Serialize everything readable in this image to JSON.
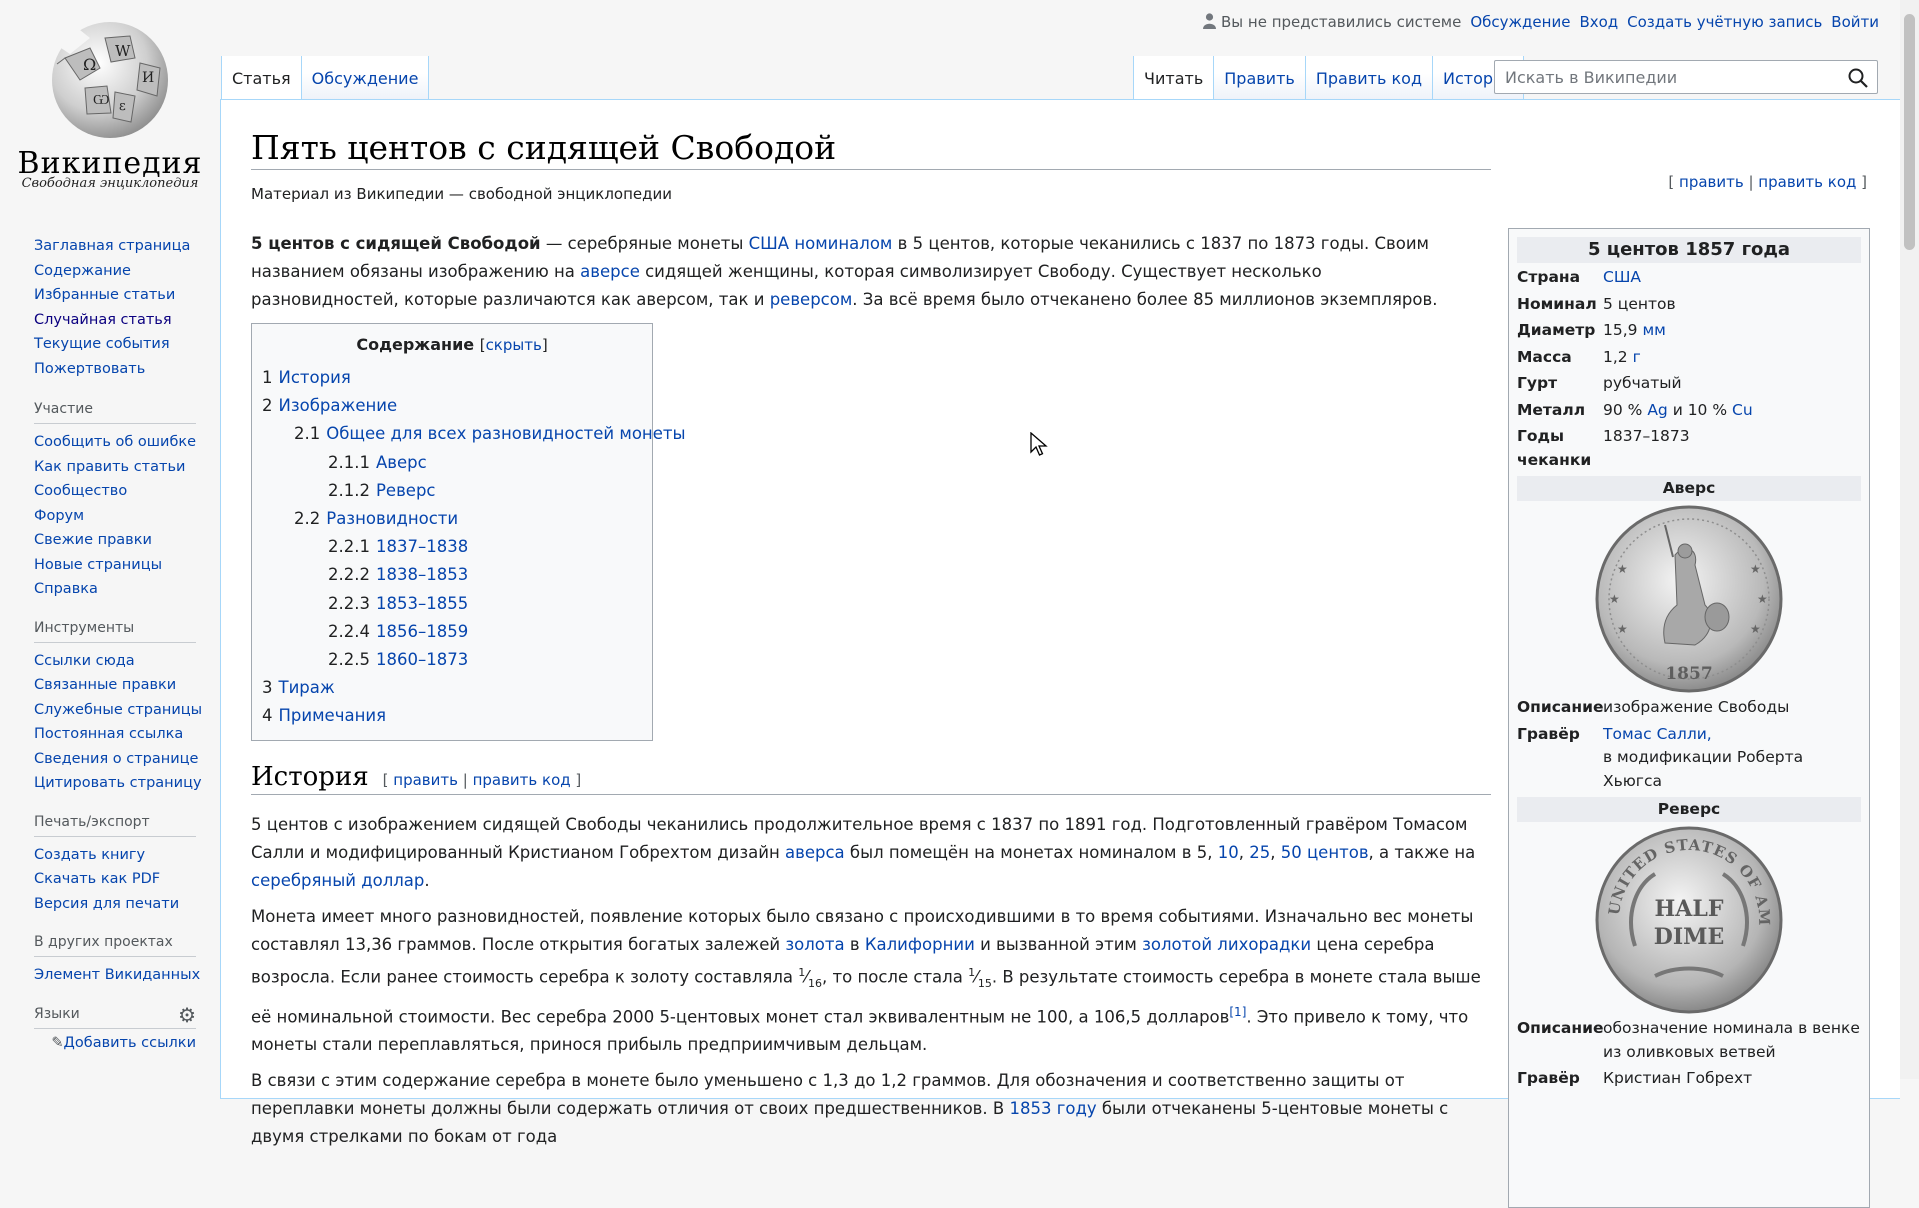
{
  "logo": {
    "wordmark": "Википедия",
    "tagline": "Свободная энциклопедия"
  },
  "nav": {
    "main": [
      "Заглавная страница",
      "Содержание",
      "Избранные статьи",
      "Случайная статья",
      "Текущие события",
      "Пожертвовать"
    ],
    "participation_title": "Участие",
    "participation": [
      "Сообщить об ошибке",
      "Как править статьи",
      "Сообщество",
      "Форум",
      "Свежие правки",
      "Новые страницы",
      "Справка"
    ],
    "tools_title": "Инструменты",
    "tools": [
      "Ссылки сюда",
      "Связанные правки",
      "Служебные страницы",
      "Постоянная ссылка",
      "Сведения о странице",
      "Цитировать страницу"
    ],
    "print_title": "Печать/экспорт",
    "print": [
      "Создать книгу",
      "Скачать как PDF",
      "Версия для печати"
    ],
    "projects_title": "В других проектах",
    "projects": [
      "Элемент Викиданных"
    ],
    "languages_title": "Языки",
    "add_links": "Добавить ссылки"
  },
  "personal": {
    "anon": "Вы не представились системе",
    "talk": "Обсуждение",
    "login": "Вход",
    "create": "Создать учётную запись",
    "logout": "Войти"
  },
  "tabs": {
    "article": "Статья",
    "discussion": "Обсуждение",
    "read": "Читать",
    "edit": "Править",
    "edit_source": "Править код",
    "history": "История"
  },
  "search": {
    "placeholder": "Искать в Википедии"
  },
  "article": {
    "title": "Пять центов с сидящей Свободой",
    "tagline": "Материал из Википедии — свободной энциклопедии",
    "edit": "править",
    "edit_source": "править код",
    "intro": {
      "bold": "5 центов с сидящей Свободой",
      "t1": " — серебряные монеты ",
      "l_usa": "США",
      "l_nom": "номиналом",
      "t2": " в 5 центов, которые чеканились с 1837 по 1873 годы. Своим названием обязаны изображению на ",
      "l_av": "аверсе",
      "t3": " сидящей женщины, которая символизирует Свободу. Существует несколько разновидностей, которые различаются как аверсом, так и ",
      "l_rev": "реверсом",
      "t4": ". За всё время было отчеканено более 85 миллионов экземпляров."
    },
    "toc": {
      "title": "Содержание",
      "toggle": "скрыть",
      "items": [
        {
          "num": "1",
          "text": "История",
          "level": 1
        },
        {
          "num": "2",
          "text": "Изображение",
          "level": 1
        },
        {
          "num": "2.1",
          "text": "Общее для всех разновидностей монеты",
          "level": 2
        },
        {
          "num": "2.1.1",
          "text": "Аверс",
          "level": 3
        },
        {
          "num": "2.1.2",
          "text": "Реверс",
          "level": 3
        },
        {
          "num": "2.2",
          "text": "Разновидности",
          "level": 2
        },
        {
          "num": "2.2.1",
          "text": "1837–1838",
          "level": 3
        },
        {
          "num": "2.2.2",
          "text": "1838–1853",
          "level": 3
        },
        {
          "num": "2.2.3",
          "text": "1853–1855",
          "level": 3
        },
        {
          "num": "2.2.4",
          "text": "1856–1859",
          "level": 3
        },
        {
          "num": "2.2.5",
          "text": "1860–1873",
          "level": 3
        },
        {
          "num": "3",
          "text": "Тираж",
          "level": 1
        },
        {
          "num": "4",
          "text": "Примечания",
          "level": 1
        }
      ]
    },
    "history": {
      "heading": "История",
      "p1a": "5 центов с изображением сидящей Свободы чеканились продолжительное время с 1837 по 1891 год. Подготовленный гравёром Томасом Салли и модифицированный Кристианом Гобрехтом дизайн ",
      "p1_l1": "аверса",
      "p1b": " был помещён на монетах номиналом в 5, ",
      "p1_l2": "10",
      "p1_l3": "25",
      "p1_l4": "50 центов",
      "p1c": ", а также на ",
      "p1_l5": "серебряный доллар",
      "p1d": ".",
      "p2a": "Монета имеет много разновидностей, появление которых было связано с происходившими в то время событиями. Изначально вес монеты составлял 13,36 граммов. После открытия богатых залежей ",
      "p2_l1": "золота",
      "p2b": " в ",
      "p2_l2": "Калифорнии",
      "p2c": " и вызванной этим ",
      "p2_l3": "золотой лихорадки",
      "p2d": " цена серебра возросла. Если ранее стоимость серебра к золоту составляла ",
      "frac1_num": "1",
      "frac1_den": "16",
      "p2e": ", то после стала ",
      "frac2_num": "1",
      "frac2_den": "15",
      "p2f": ". В результате стоимость серебра в монете стала выше её номинальной стоимости. Вес серебра 2000 5-центовых монет стал эквивалентным не 100, а 106,5 долларов",
      "ref": "[1]",
      "p2g": ". Это привело к тому, что монеты стали переплавляться, принося прибыль предприимчивым дельцам.",
      "p3a": "В связи с этим содержание серебра в монете было уменьшено с 1,3 до 1,2 граммов. Для обозначения и соответственно защиты от переплавки монеты должны были содержать отличия от своих предшественников. В ",
      "p3_l1": "1853 году",
      "p3b": " были отчеканены 5-центовые монеты с двумя стрелками по бокам от года"
    }
  },
  "infobox": {
    "caption": "5 центов 1857 года",
    "country_k": "Страна",
    "country_v": "США",
    "nominal_k": "Номинал",
    "nominal_v": "5 центов",
    "diam_k": "Диаметр",
    "diam_v": "15,9 ",
    "diam_u": "мм",
    "mass_k": "Масса",
    "mass_v": "1,2 ",
    "mass_u": "г",
    "edge_k": "Гурт",
    "edge_v": "рубчатый",
    "metal_k": "Металл",
    "metal_v1": "90 % ",
    "metal_ag": "Ag",
    "metal_v2": " и 10 % ",
    "metal_cu": "Cu",
    "years_k": "Годы чеканки",
    "years_v": "1837–1873",
    "obverse": "Аверс",
    "obv_desc_k": "Описание",
    "obv_desc_v": "изображение Свободы",
    "obv_eng_k": "Гравёр",
    "obv_eng_v": "Томас Салли,",
    "obv_eng_v2": "в модификации Роберта Хьюгса",
    "reverse": "Реверс",
    "rev_desc_k": "Описание",
    "rev_desc_v": "обозначение номинала в венке из оливковых ветвей",
    "rev_eng_k": "Гравёр",
    "rev_eng_v": "Кристиан Гобрехт",
    "obv_year": "1857",
    "rev_text1": "HALF",
    "rev_text2": "DIME",
    "rev_ring": "UNITED STATES OF AMERICA"
  },
  "colors": {
    "link": "#0645ad",
    "border": "#a7d7f9",
    "text": "#202122"
  }
}
